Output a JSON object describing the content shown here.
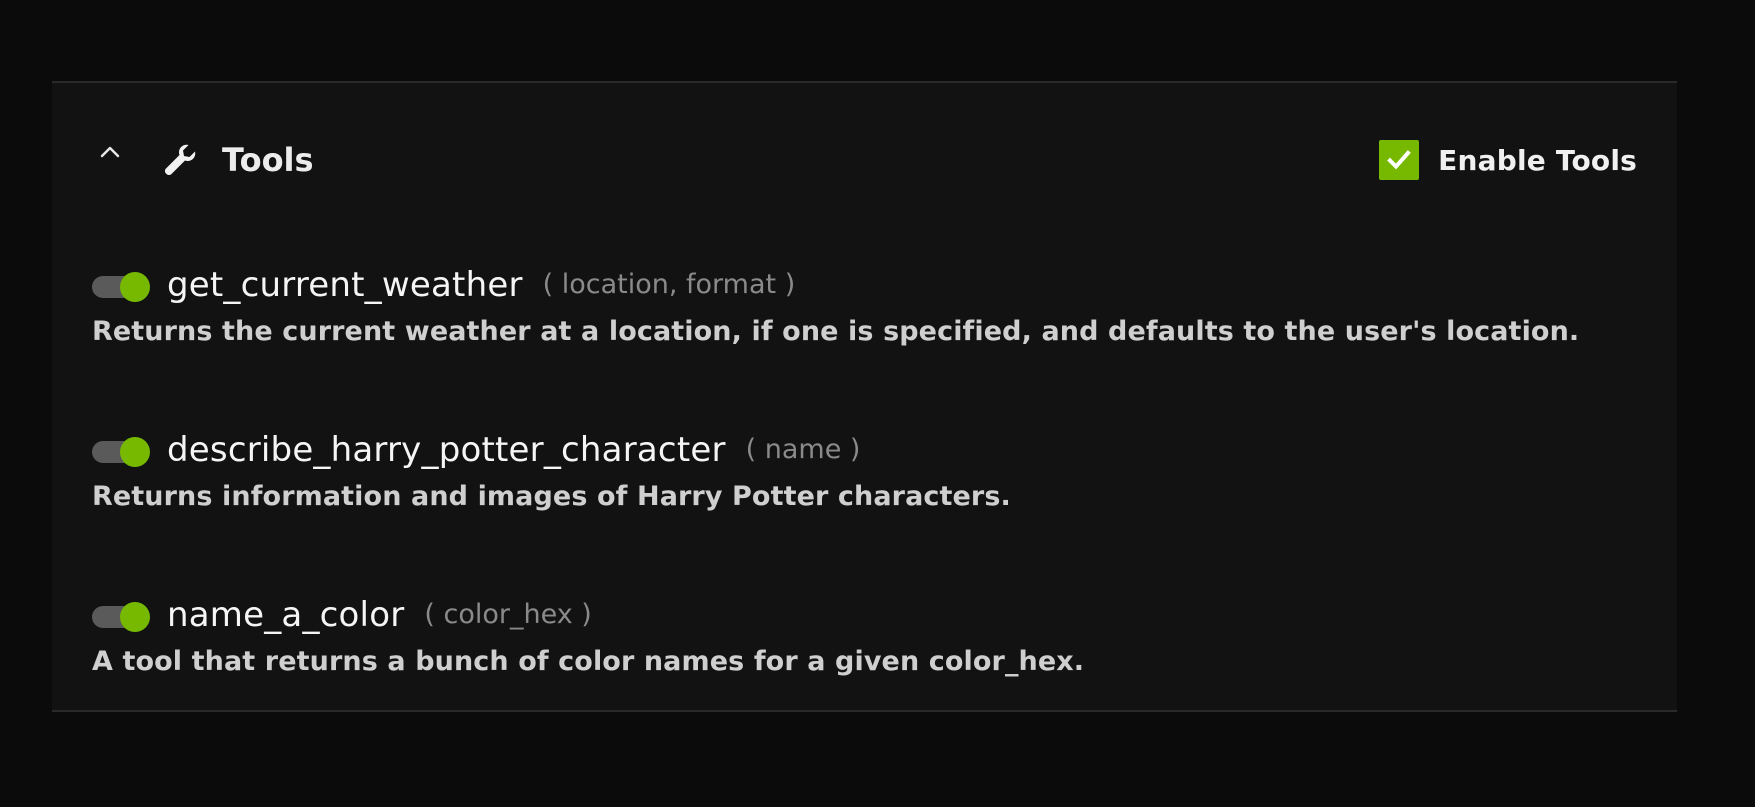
{
  "panel": {
    "title": "Tools",
    "enable_label": "Enable Tools",
    "enable_checked": true
  },
  "colors": {
    "accent": "#76b900",
    "background": "#0b0b0b",
    "panel": "#121212"
  },
  "tools": [
    {
      "name": "get_current_weather",
      "args": "( location, format )",
      "description": "Returns the current weather at a location, if one is specified, and defaults to the user's location.",
      "enabled": true
    },
    {
      "name": "describe_harry_potter_character",
      "args": "( name )",
      "description": "Returns information and images of Harry Potter characters.",
      "enabled": true
    },
    {
      "name": "name_a_color",
      "args": "( color_hex )",
      "description": "A tool that returns a bunch of color names for a given color_hex.",
      "enabled": true
    }
  ],
  "icons": {
    "collapse": "chevron-up-icon",
    "tools": "wrench-icon",
    "check": "checkmark-icon"
  }
}
